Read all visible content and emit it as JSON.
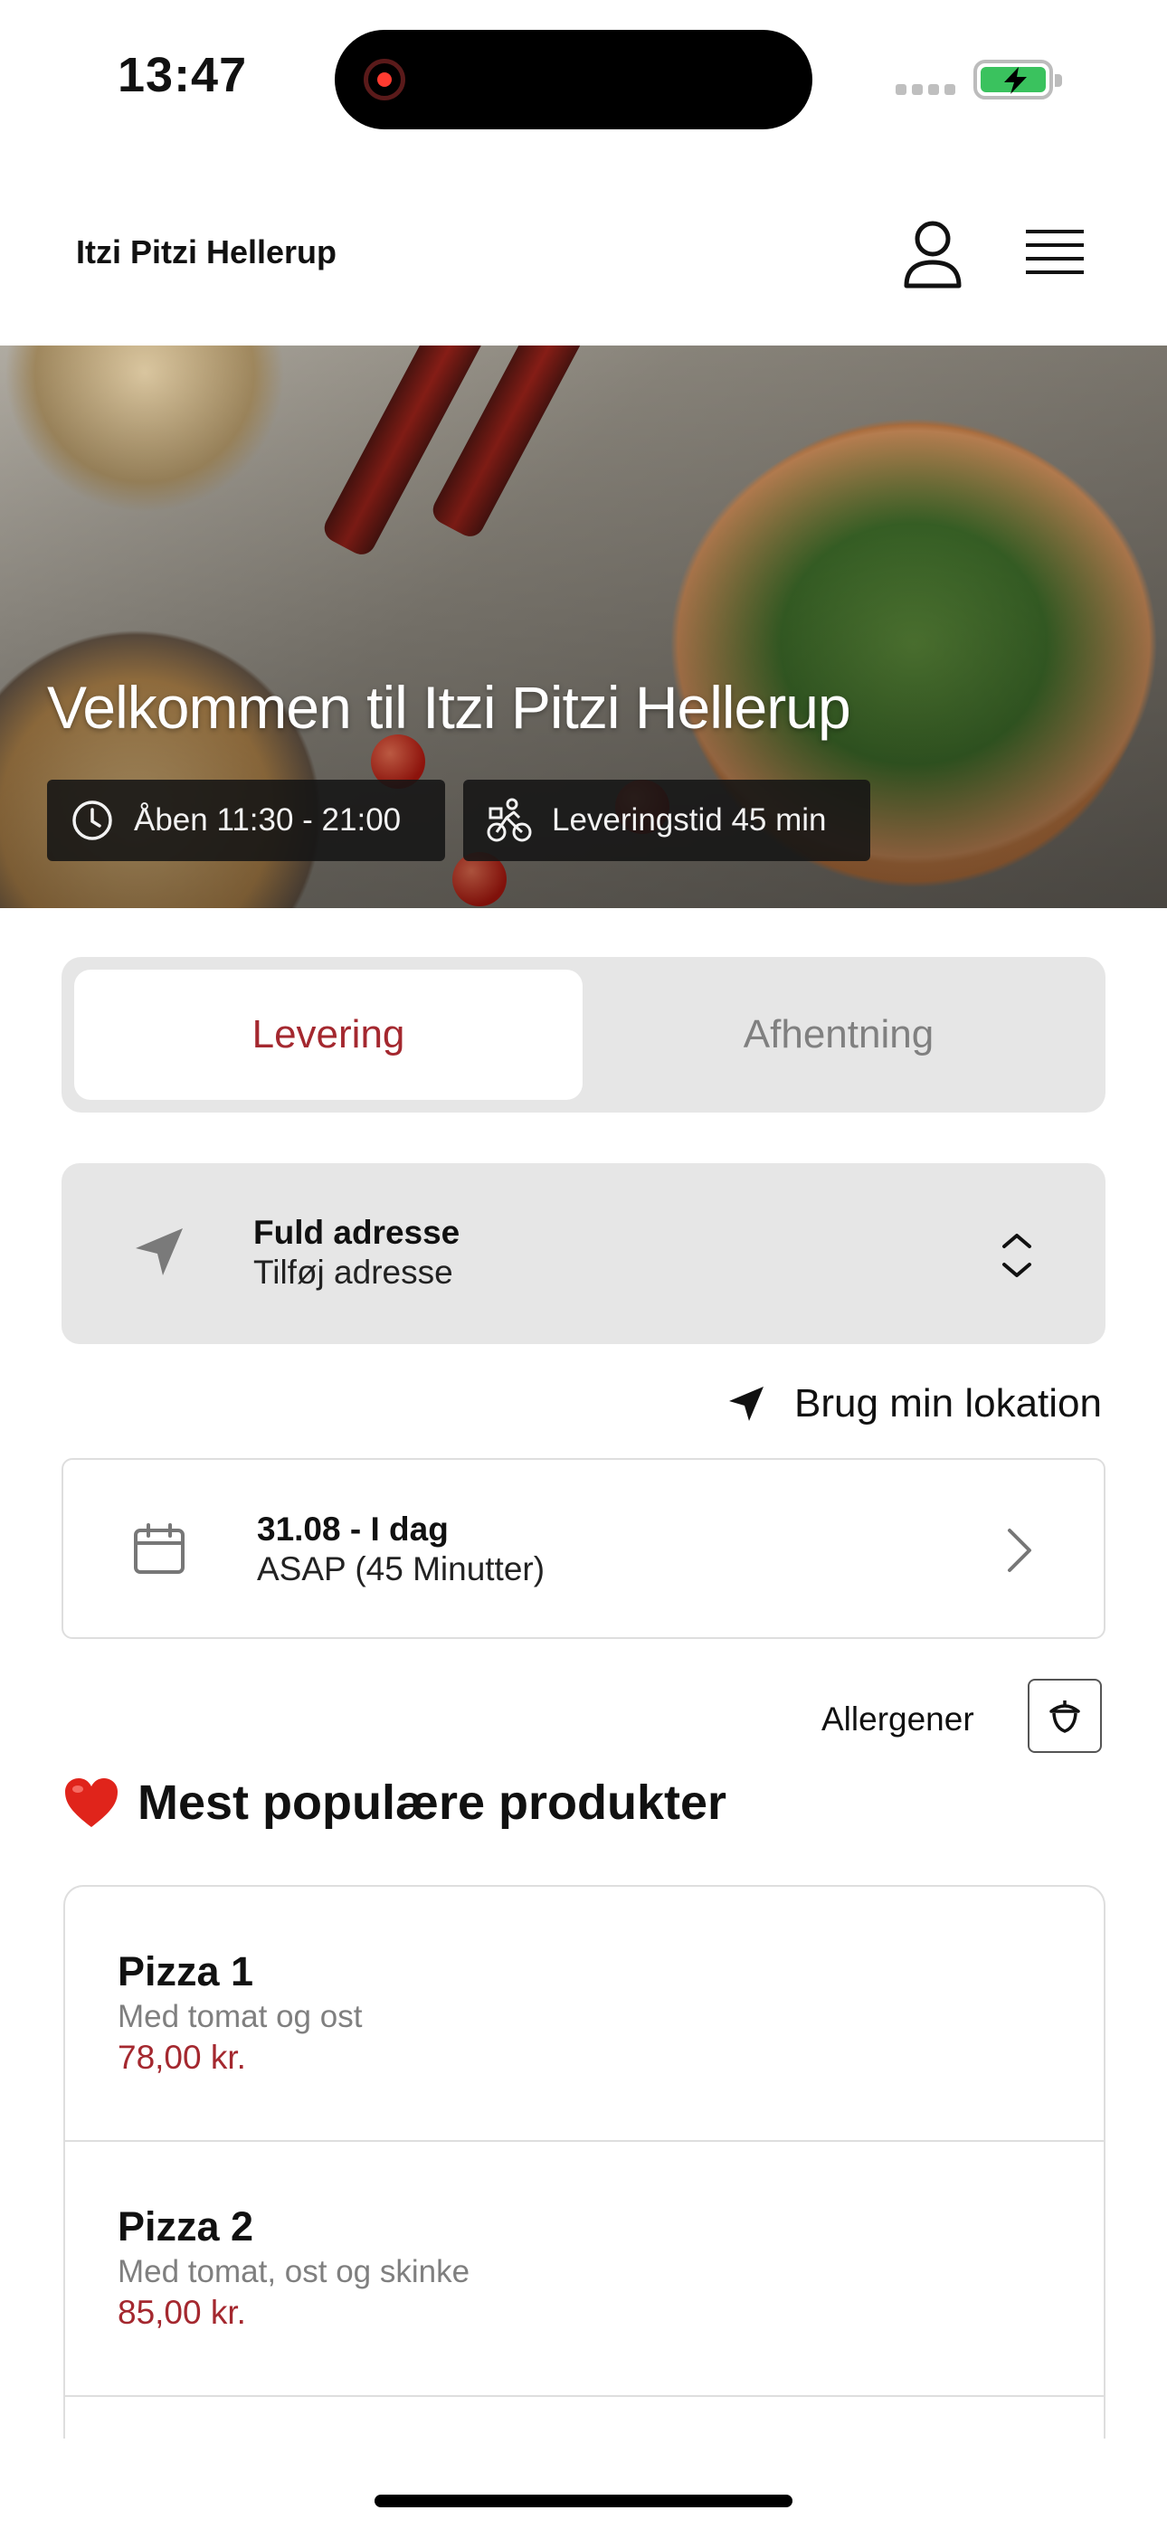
{
  "status_bar": {
    "time": "13:47"
  },
  "header": {
    "store_name": "Itzi Pitzi Hellerup"
  },
  "hero": {
    "title": "Velkommen til Itzi Pitzi Hellerup",
    "open_hours": "Åben 11:30 - 21:00",
    "delivery_time": "Leveringstid 45 min"
  },
  "order_mode": {
    "options": [
      {
        "label": "Levering",
        "selected": true
      },
      {
        "label": "Afhentning",
        "selected": false
      }
    ]
  },
  "address": {
    "title": "Fuld adresse",
    "value": "Tilføj adresse"
  },
  "use_location": "Brug min lokation",
  "date": {
    "title": "31.08 - I dag",
    "value": "ASAP (45 Minutter)"
  },
  "allergens": {
    "label": "Allergener"
  },
  "popular": {
    "title": "Mest populære produkter",
    "products": [
      {
        "name": "Pizza 1",
        "description": "Med tomat og ost",
        "price": "78,00 kr."
      },
      {
        "name": "Pizza 2",
        "description": "Med tomat, ost og skinke",
        "price": "85,00 kr."
      }
    ]
  },
  "colors": {
    "accent": "#a4282f",
    "surface": "#e6e6e6",
    "border": "#dedede"
  }
}
